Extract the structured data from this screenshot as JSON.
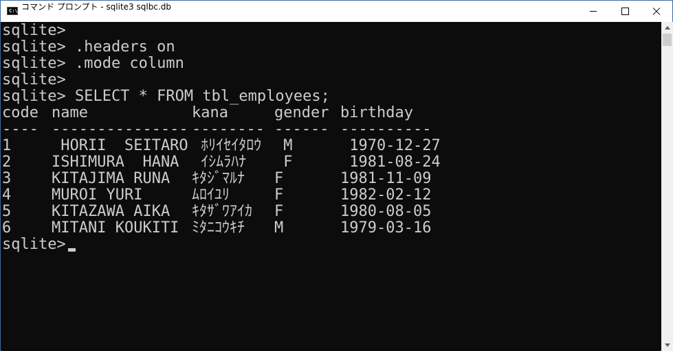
{
  "window": {
    "title": "コマンド プロンプト - sqlite3  sqlbc.db"
  },
  "console": {
    "prompt": "sqlite>",
    "commands": [
      "sqlite>",
      "sqlite> .headers on",
      "sqlite> .mode column",
      "sqlite>",
      "sqlite> SELECT * FROM tbl_employees;"
    ],
    "table": {
      "headers": [
        "code",
        "name",
        "kana",
        "gender",
        "birthday"
      ],
      "separators": [
        "----",
        "---------------",
        "--------",
        "------",
        "----------"
      ],
      "rows": [
        [
          "1",
          " HORII  SEITARO",
          " ﾎﾘｲｾｲﾀﾛｳ",
          " M",
          " 1970-12-27"
        ],
        [
          "2",
          "ISHIMURA  HANA",
          " ｲｼﾑﾗﾊﾅ",
          " F",
          " 1981-08-24"
        ],
        [
          "3",
          "KITAJIMA RUNA",
          "ｷﾀｼﾞﾏﾙﾅ",
          "F",
          "1981-11-09"
        ],
        [
          "4",
          "MUROI YURI",
          "ﾑﾛｲﾕﾘ",
          "F",
          "1982-02-12"
        ],
        [
          "5",
          "KITAZAWA AIKA",
          "ｷﾀｻﾞﾜｱｲｶ",
          "F",
          "1980-08-05"
        ],
        [
          "6",
          "MITANI KOUKITI",
          "ﾐﾀﾆｺｳｷﾁ",
          "M",
          "1979-03-16"
        ]
      ]
    },
    "final_prompt": "sqlite>"
  },
  "icons": {
    "app": "cmd-icon",
    "minimize": "minimize-icon",
    "maximize": "maximize-icon",
    "close": "close-icon"
  }
}
